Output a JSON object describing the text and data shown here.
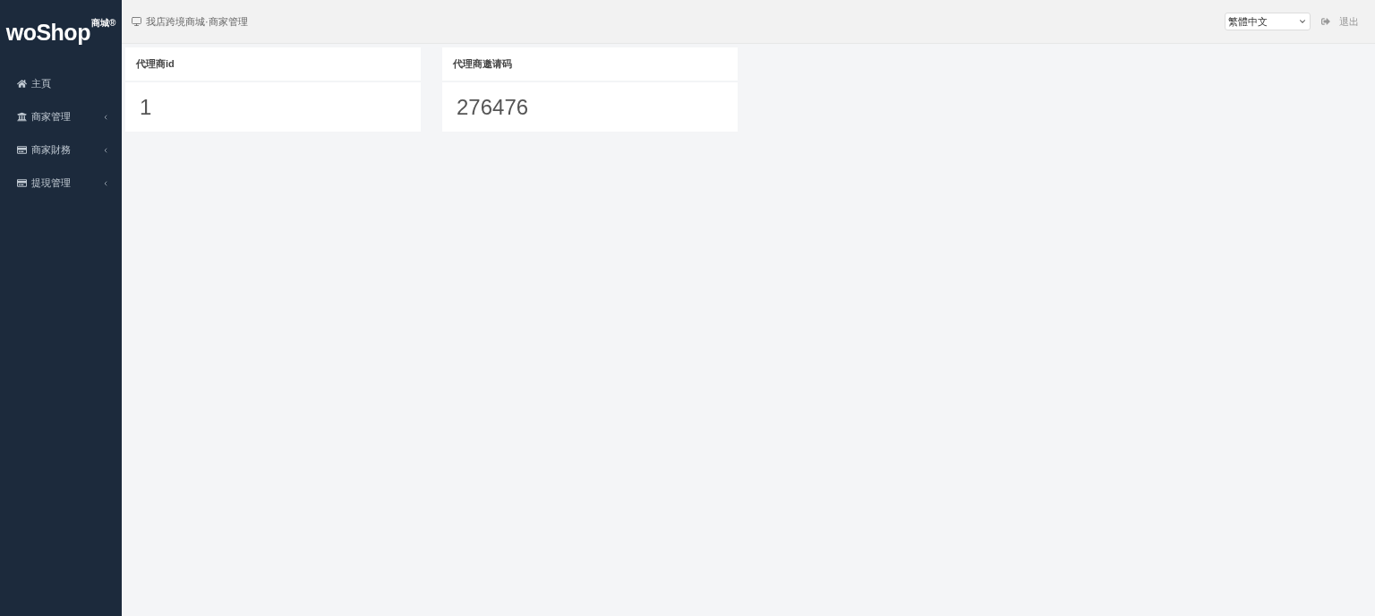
{
  "sidebar": {
    "logo": {
      "wordmark": "woShop",
      "badge": "商城®"
    },
    "items": [
      {
        "kind": "link",
        "label": "主頁",
        "selected": false
      },
      {
        "kind": "menu",
        "label": "商家管理",
        "selected": false,
        "expanded": false
      },
      {
        "kind": "menu",
        "label": "商家財務",
        "selected": false,
        "expanded": false
      },
      {
        "kind": "menu",
        "label": "提現管理",
        "selected": false,
        "expanded": false
      }
    ]
  },
  "header": {
    "breadcrumb": "我店跨境商城·商家管理",
    "language": {
      "value": "繁體中文"
    },
    "logout": "退出"
  },
  "cards": [
    {
      "title": "代理商id",
      "value": "1"
    },
    {
      "title": "代理商邀请码",
      "value": "276476"
    }
  ]
}
